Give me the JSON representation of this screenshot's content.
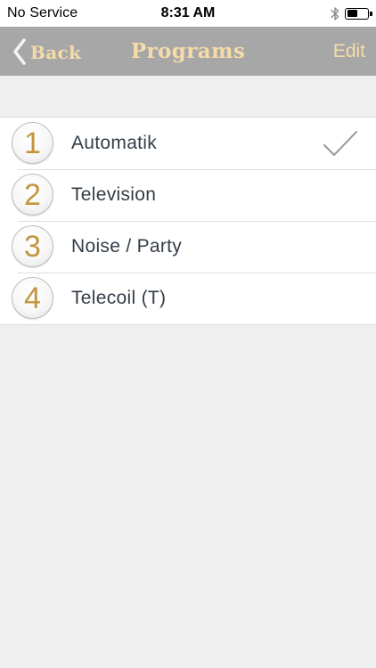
{
  "status_bar": {
    "carrier": "No Service",
    "time": "8:31 AM",
    "bluetooth_icon": "bluetooth-icon",
    "battery_icon": "battery-icon",
    "battery_level": 0.55
  },
  "nav_bar": {
    "back_label": "Back",
    "back_icon": "chevron-left-icon",
    "title": "Programs",
    "edit_label": "Edit"
  },
  "programs": [
    {
      "number": "1",
      "label": "Automatik",
      "selected": true
    },
    {
      "number": "2",
      "label": "Television",
      "selected": false
    },
    {
      "number": "3",
      "label": "Noise / Party",
      "selected": false
    },
    {
      "number": "4",
      "label": "Telecoil (T)",
      "selected": false
    }
  ],
  "colors": {
    "accent_gold": "#c4953f",
    "nav_text": "#f5dca8",
    "nav_background": "#a7a7a7",
    "list_text": "#333d47",
    "background": "#efefef"
  }
}
